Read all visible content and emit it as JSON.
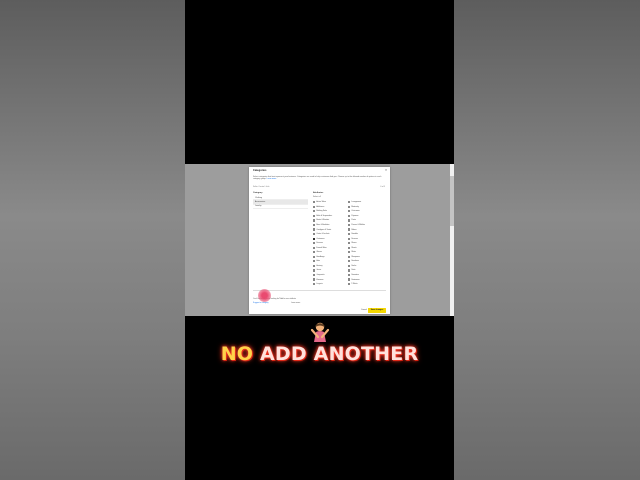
{
  "dialog": {
    "title": "Categories",
    "close_icon": "×",
    "description": "Select categories that best represent your business. Categories are used to help customers find you. Choose up to the allowed number of options in each category group.",
    "description_link": "Learn more",
    "breadcrumb": "Seller Central › Info",
    "selected_count": "0 of 5",
    "categories_heading": "Category",
    "categories": [
      {
        "label": "Clothing",
        "active": false
      },
      {
        "label": "Accessories",
        "active": true
      },
      {
        "label": "Jewelry",
        "active": false
      }
    ],
    "attributes_heading": "Attributes",
    "attributes_subheading": "Select all",
    "attributes_col1": [
      {
        "label": "Active Wear",
        "checked": false
      },
      {
        "label": "Athleisure",
        "checked": false
      },
      {
        "label": "Bathing Suits",
        "checked": false
      },
      {
        "label": "Belts & Suspenders",
        "checked": false
      },
      {
        "label": "Boots & Booties",
        "checked": false
      },
      {
        "label": "Bras & Bralettes",
        "checked": false
      },
      {
        "label": "Cardigans & Vests",
        "checked": false
      },
      {
        "label": "Coats & Jackets",
        "checked": false
      },
      {
        "label": "Costumes",
        "checked": true
      },
      {
        "label": "Dresses",
        "checked": false
      },
      {
        "label": "Formal Wear",
        "checked": false
      },
      {
        "label": "Gloves",
        "checked": false
      },
      {
        "label": "Handbags",
        "checked": false
      },
      {
        "label": "Hats",
        "checked": false
      },
      {
        "label": "Hosiery",
        "checked": false
      },
      {
        "label": "Jeans",
        "checked": false
      },
      {
        "label": "Jumpsuits",
        "checked": false
      },
      {
        "label": "Kimonos",
        "checked": false
      },
      {
        "label": "Lingerie",
        "checked": false
      }
    ],
    "attributes_col2": [
      {
        "label": "Loungewear",
        "checked": false
      },
      {
        "label": "Maternity",
        "checked": false
      },
      {
        "label": "Outerwear",
        "checked": false
      },
      {
        "label": "Pajamas",
        "checked": false
      },
      {
        "label": "Pants",
        "checked": false
      },
      {
        "label": "Purses & Wallets",
        "checked": false
      },
      {
        "label": "Robes",
        "checked": false
      },
      {
        "label": "Sandals",
        "checked": false
      },
      {
        "label": "Scarves",
        "checked": false
      },
      {
        "label": "Shoes",
        "checked": false
      },
      {
        "label": "Shorts",
        "checked": false
      },
      {
        "label": "Skirts",
        "checked": false
      },
      {
        "label": "Sleepwear",
        "checked": false
      },
      {
        "label": "Sneakers",
        "checked": false
      },
      {
        "label": "Socks",
        "checked": false
      },
      {
        "label": "Suits",
        "checked": false
      },
      {
        "label": "Sweaters",
        "checked": false
      },
      {
        "label": "Swimwear",
        "checked": false
      },
      {
        "label": "T-Shirts",
        "checked": false
      }
    ],
    "helper_text": "Can't find what you're looking for? Add a new attribute",
    "helper_link": "Suggest a category",
    "helper_extra": "Learn more",
    "cancel_label": "Cancel",
    "save_label": "Save changes"
  },
  "caption": {
    "emoji": "🙅",
    "no": "NO",
    "rest": "ADD ANOTHER",
    "colors": {
      "no": "#ffd24a",
      "rest": "#ffe2dc",
      "glow": "#ff3a2a"
    }
  }
}
